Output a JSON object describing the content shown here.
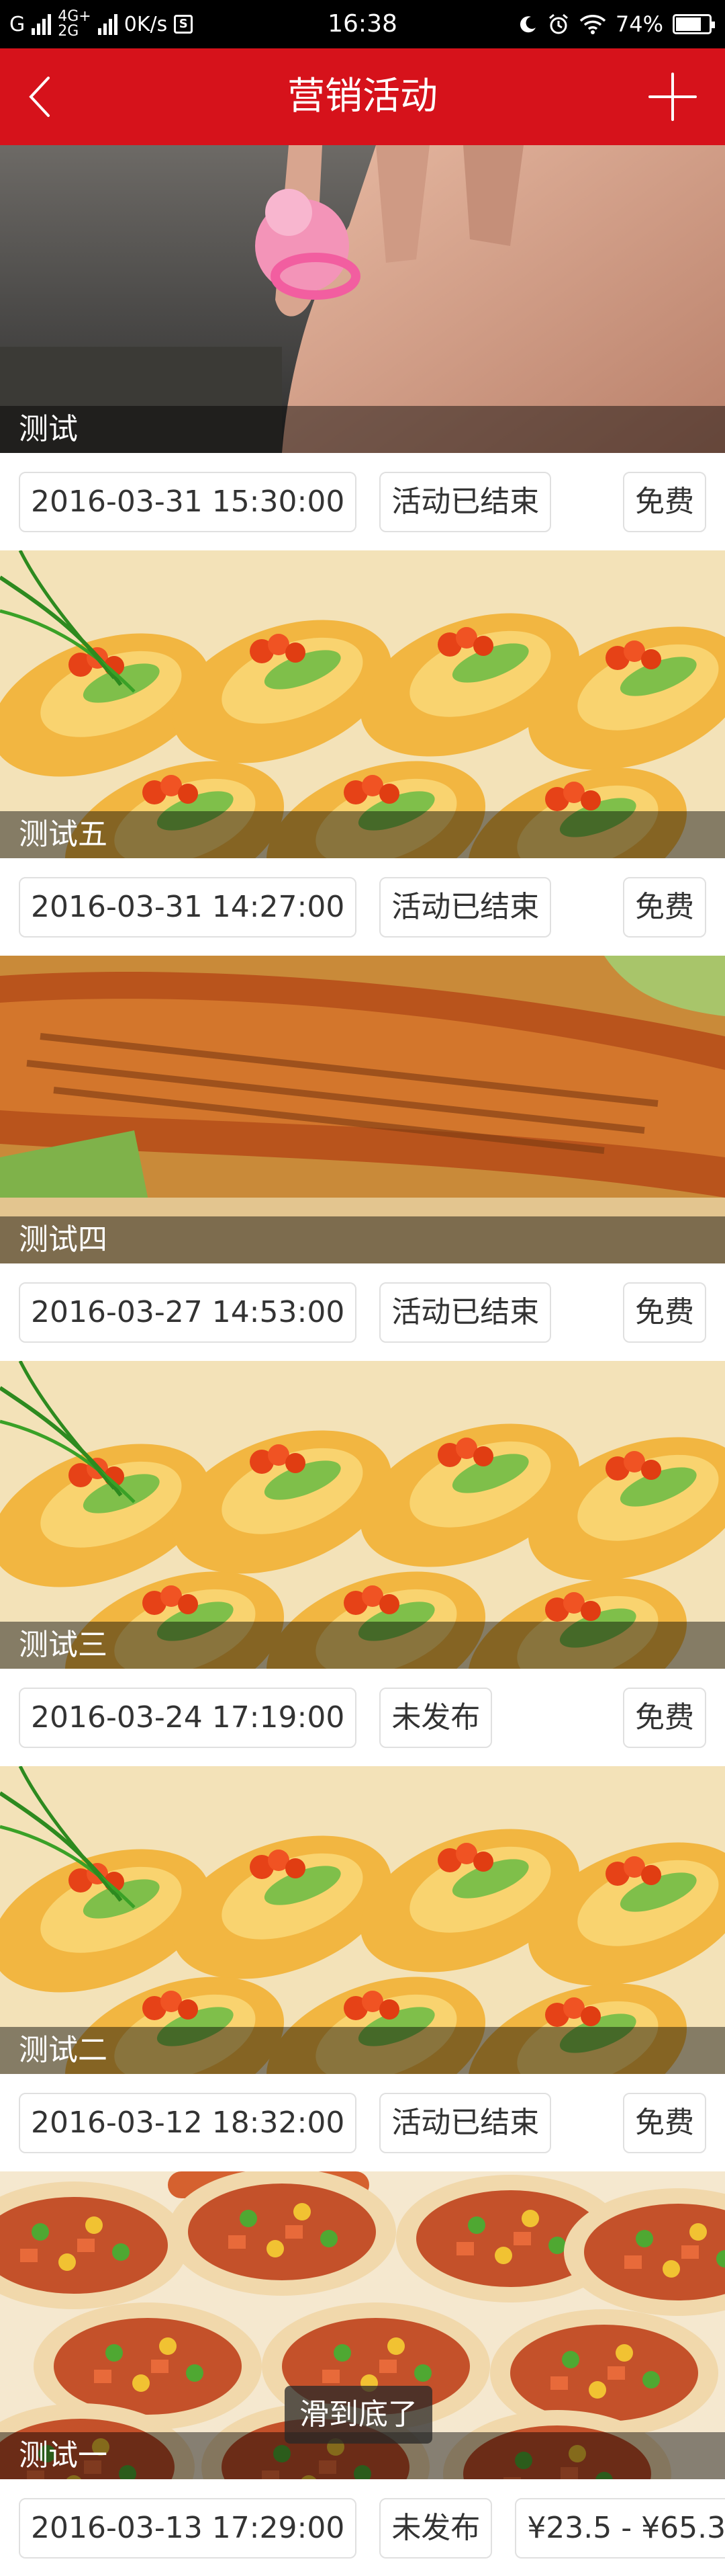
{
  "status_bar": {
    "carrier": "G",
    "network_top": "4G+",
    "network_bottom": "2G",
    "speed": "0K/s",
    "time": "16:38",
    "battery": "74%",
    "battery_level": 0.74
  },
  "header": {
    "title": "营销活动",
    "back_icon": "chevron-left-icon",
    "add_icon": "plus-icon",
    "color": "#d6121b"
  },
  "activities": [
    {
      "name": "测试",
      "datetime": "2016-03-31 15:30:00",
      "status": "活动已结束",
      "price": "免费",
      "image": "hand-ring"
    },
    {
      "name": "测试五",
      "datetime": "2016-03-31 14:27:00",
      "status": "活动已结束",
      "price": "免费",
      "image": "crepes"
    },
    {
      "name": "测试四",
      "datetime": "2016-03-27 14:53:00",
      "status": "活动已结束",
      "price": "免费",
      "image": "grilled-fish"
    },
    {
      "name": "测试三",
      "datetime": "2016-03-24 17:19:00",
      "status": "未发布",
      "price": "免费",
      "image": "crepes"
    },
    {
      "name": "测试二",
      "datetime": "2016-03-12 18:32:00",
      "status": "活动已结束",
      "price": "免费",
      "image": "crepes"
    },
    {
      "name": "测试一",
      "datetime": "2016-03-13 17:29:00",
      "status": "未发布",
      "price": "¥23.5 - ¥65.3",
      "image": "pizzas"
    }
  ],
  "toast": "滑到底了"
}
